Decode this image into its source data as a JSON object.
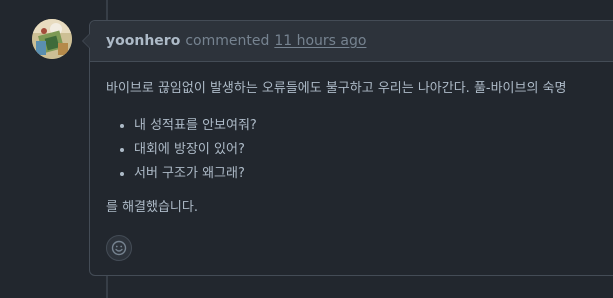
{
  "comment": {
    "author": "yoonhero",
    "action": "commented",
    "timestamp": "11 hours ago",
    "body": {
      "intro": "바이브로 끊임없이 발생하는 오류들에도 불구하고 우리는 나아간다. 풀-바이브의 숙명",
      "items": [
        "내 성적표를 안보여줘?",
        "대회에 방장이 있어?",
        "서버 구조가 왜그래?"
      ],
      "outro": "를 해결했습니다."
    },
    "reaction_icon": "smiley-icon"
  },
  "colors": {
    "background": "#22272e",
    "header_background": "#2d333b",
    "border": "#444c56",
    "text_primary": "#adbac7",
    "text_muted": "#768390"
  }
}
